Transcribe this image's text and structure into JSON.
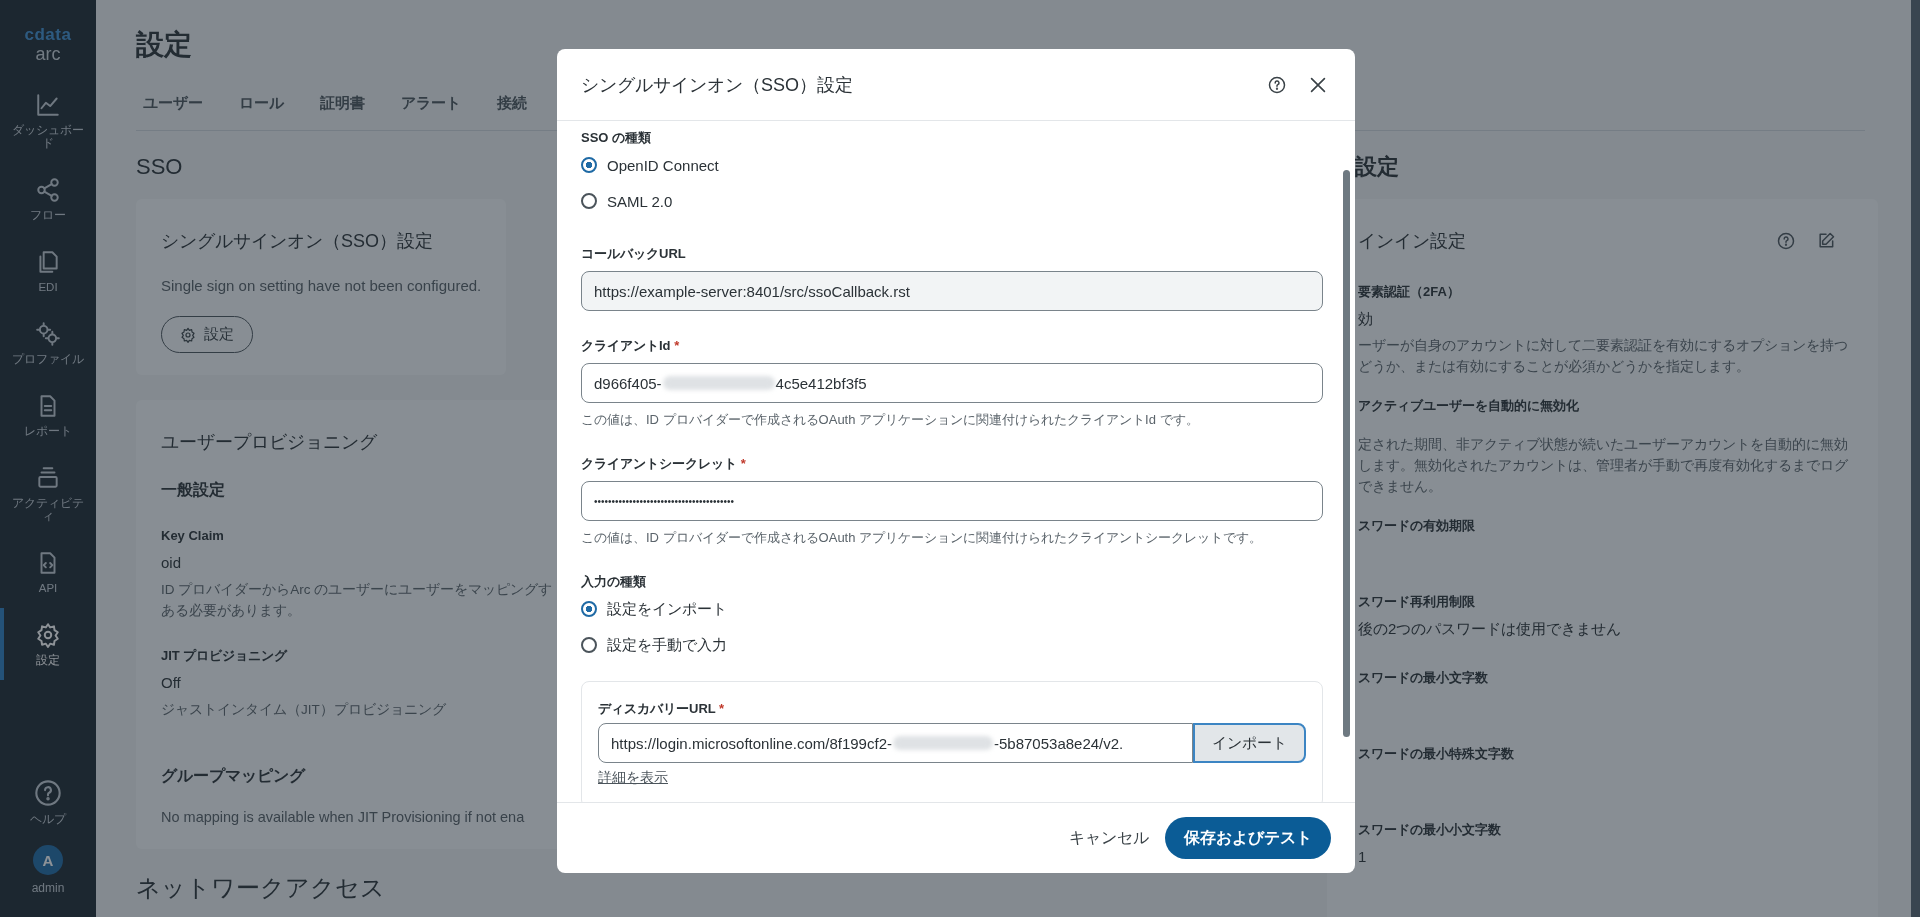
{
  "sidebar": {
    "logo": {
      "brand": "cdata",
      "product": "arc"
    },
    "items": [
      {
        "label": "ダッシュボード",
        "selected": false
      },
      {
        "label": "フロー",
        "selected": false
      },
      {
        "label": "EDI",
        "selected": false
      },
      {
        "label": "プロファイル",
        "selected": false
      },
      {
        "label": "レポート",
        "selected": false
      },
      {
        "label": "アクティビティ",
        "selected": false
      },
      {
        "label": "API",
        "selected": false
      },
      {
        "label": "設定",
        "selected": true
      }
    ],
    "help": {
      "label": "ヘルプ"
    },
    "user": {
      "initial": "A",
      "name": "admin"
    }
  },
  "page": {
    "title": "設定",
    "tabs": [
      {
        "label": "ユーザー",
        "selected": false
      },
      {
        "label": "ロール",
        "selected": false
      },
      {
        "label": "証明書",
        "selected": false
      },
      {
        "label": "アラート",
        "selected": false
      },
      {
        "label": "接続",
        "selected": false
      }
    ],
    "section_title": "SSO",
    "sso_card": {
      "title": "シングルサインオン（SSO）設定",
      "message": "Single sign on setting have not been configured.",
      "button": "設定"
    },
    "provisioning_card": {
      "title": "ユーザープロビジョニング",
      "subtitle": "一般設定",
      "fields": [
        {
          "label": "Key Claim",
          "value": "oid",
          "description": [
            "ID プロバイダーからArc のユーザーにユーザーをマッピングす",
            "ある必要があります。"
          ]
        },
        {
          "label": "JIT プロビジョニング",
          "value": "Off",
          "description": [
            "ジャストインタイム（JIT）プロビジョニング"
          ]
        }
      ],
      "group_title": "グループマッピング",
      "group_message": "No mapping is available when JIT Provisioning if not ena"
    },
    "next_section_title": "ネットワークアクセス"
  },
  "right_panel": {
    "title": "設定",
    "card_title": "インイン設定",
    "settings": [
      {
        "label": "要素認証（2FA）",
        "value": "効",
        "description": [
          "ーザーが自身のアカウントに対して二要素認証を有効にするオプションを持つ",
          "どうか、または有効にすることが必須かどうかを指定します。"
        ]
      },
      {
        "label": "アクティブユーザーを自動的に無効化",
        "description": [
          "定された期間、非アクティブ状態が続いたユーザーアカウントを自動的に無効",
          "します。無効化されたアカウントは、管理者が手動で再度有効化するまでログ",
          "できません。"
        ]
      },
      {
        "label": "スワードの有効期限"
      },
      {
        "label": "スワード再利用制限",
        "value": "後の2つのパスワードは使用できません"
      },
      {
        "label": "スワードの最小文字数"
      },
      {
        "label": "スワードの最小特殊文字数"
      },
      {
        "label": "スワードの最小小文字数",
        "value": "1"
      }
    ]
  },
  "dialog": {
    "title": "シングルサインオン（SSO）設定",
    "sso_type": {
      "label": "SSO の種類",
      "options": [
        {
          "label": "OpenID Connect",
          "selected": true
        },
        {
          "label": "SAML 2.0",
          "selected": false
        }
      ]
    },
    "callback_url": {
      "label": "コールバックURL",
      "value": "https://example-server:8401/src/ssoCallback.rst",
      "readonly": true
    },
    "client_id": {
      "label": "クライアントId",
      "required_mark": "*",
      "value_start": "d966f405-",
      "value_end": "4c5e412bf3f5",
      "redacted": true,
      "help": "この値は、ID プロバイダーで作成されるOAuth アプリケーションに関連付けられたクライアントId です。"
    },
    "client_secret": {
      "label": "クライアントシークレット",
      "required_mark": "*",
      "value": "••••••••••••••••••••••••••••••••••••••••",
      "help": "この値は、ID プロバイダーで作成されるOAuth アプリケーションに関連付けられたクライアントシークレットです。"
    },
    "input_type": {
      "label": "入力の種類",
      "options": [
        {
          "label": "設定をインポート",
          "selected": true
        },
        {
          "label": "設定を手動で入力",
          "selected": false
        }
      ]
    },
    "discovery": {
      "label": "ディスカバリーURL",
      "required_mark": "*",
      "value_start": "https://login.microsoftonline.com/8f199cf2-",
      "value_end": "-5b87053a8e24/v2.",
      "redacted": true,
      "button": "インポート",
      "link": "詳細を表示"
    },
    "cancel": "キャンセル",
    "save": "保存およびテスト"
  }
}
